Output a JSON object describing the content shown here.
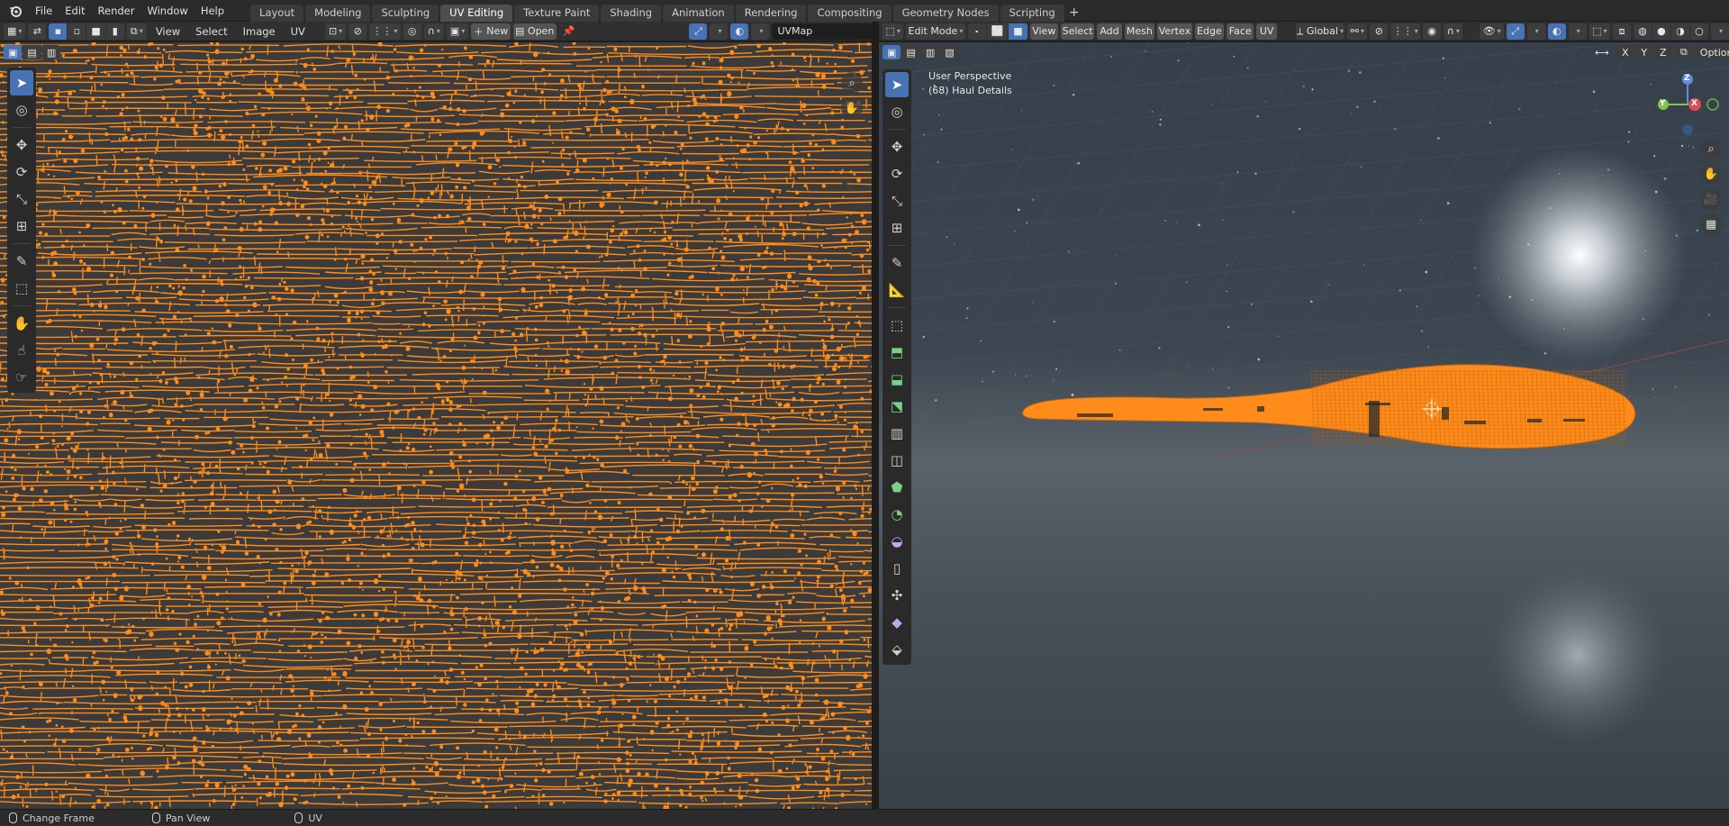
{
  "top_menu": {
    "items": [
      "File",
      "Edit",
      "Render",
      "Window",
      "Help"
    ]
  },
  "workspace_tabs": [
    {
      "label": "Layout",
      "active": false
    },
    {
      "label": "Modeling",
      "active": false
    },
    {
      "label": "Sculpting",
      "active": false
    },
    {
      "label": "UV Editing",
      "active": true
    },
    {
      "label": "Texture Paint",
      "active": false
    },
    {
      "label": "Shading",
      "active": false
    },
    {
      "label": "Animation",
      "active": false
    },
    {
      "label": "Rendering",
      "active": false
    },
    {
      "label": "Compositing",
      "active": false
    },
    {
      "label": "Geometry Nodes",
      "active": false
    },
    {
      "label": "Scripting",
      "active": false
    }
  ],
  "uv_header": {
    "menus": [
      "View",
      "Select",
      "Image",
      "UV"
    ],
    "new_label": "New",
    "open_label": "Open",
    "uvmap_value": "UVMap"
  },
  "viewport_header": {
    "mode": "Edit Mode",
    "menus": [
      "View",
      "Select",
      "Add",
      "Mesh",
      "Vertex",
      "Edge",
      "Face",
      "UV"
    ],
    "orientation": "Global",
    "options_label": "Options",
    "axes": [
      "X",
      "Y",
      "Z"
    ]
  },
  "viewport_overlay": {
    "perspective": "User Perspective",
    "object": "(68) Haul Details"
  },
  "gizmo": {
    "z": "Z",
    "y": "Y",
    "x": "X"
  },
  "status_bar": {
    "change_frame": "Change Frame",
    "pan_view": "Pan View",
    "uv": "UV"
  },
  "colors": {
    "accent_blue": "#4772b3",
    "mesh_orange": "#ff8c1a",
    "header": "#303030"
  }
}
